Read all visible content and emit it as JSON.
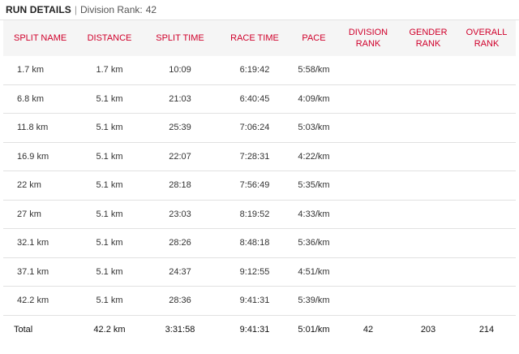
{
  "header": {
    "title": "RUN DETAILS",
    "separator": "|",
    "subtitle_label": "Division Rank:",
    "subtitle_value": "42"
  },
  "columns": [
    [
      "SPLIT NAME"
    ],
    [
      "DISTANCE"
    ],
    [
      "SPLIT TIME"
    ],
    [
      "RACE TIME"
    ],
    [
      "PACE"
    ],
    [
      "DIVISION",
      "RANK"
    ],
    [
      "GENDER",
      "RANK"
    ],
    [
      "OVERALL",
      "RANK"
    ]
  ],
  "rows": [
    [
      "1.7 km",
      "1.7 km",
      "10:09",
      "6:19:42",
      "5:58/km",
      "",
      "",
      ""
    ],
    [
      "6.8 km",
      "5.1 km",
      "21:03",
      "6:40:45",
      "4:09/km",
      "",
      "",
      ""
    ],
    [
      "11.8 km",
      "5.1 km",
      "25:39",
      "7:06:24",
      "5:03/km",
      "",
      "",
      ""
    ],
    [
      "16.9 km",
      "5.1 km",
      "22:07",
      "7:28:31",
      "4:22/km",
      "",
      "",
      ""
    ],
    [
      "22 km",
      "5.1 km",
      "28:18",
      "7:56:49",
      "5:35/km",
      "",
      "",
      ""
    ],
    [
      "27 km",
      "5.1 km",
      "23:03",
      "8:19:52",
      "4:33/km",
      "",
      "",
      ""
    ],
    [
      "32.1 km",
      "5.1 km",
      "28:26",
      "8:48:18",
      "5:36/km",
      "",
      "",
      ""
    ],
    [
      "37.1 km",
      "5.1 km",
      "24:37",
      "9:12:55",
      "4:51/km",
      "",
      "",
      ""
    ],
    [
      "42.2 km",
      "5.1 km",
      "28:36",
      "9:41:31",
      "5:39/km",
      "",
      "",
      ""
    ]
  ],
  "total": [
    "Total",
    "42.2 km",
    "3:31:58",
    "9:41:31",
    "5:01/km",
    "42",
    "203",
    "214"
  ],
  "colors": {
    "header_text": "#d0002b",
    "header_bg": "#f5f5f5",
    "row_divider": "#e1e1e1"
  }
}
